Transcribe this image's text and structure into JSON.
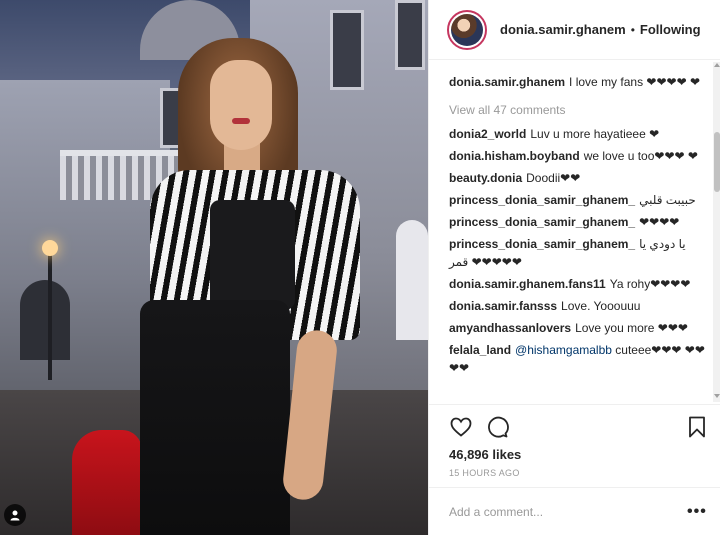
{
  "header": {
    "username": "donia.samir.ghanem",
    "separator": "•",
    "follow_status": "Following"
  },
  "caption": {
    "username": "donia.samir.ghanem",
    "text": "I love my fans ❤❤❤❤ ❤"
  },
  "view_all_comments": "View all 47 comments",
  "comments": [
    {
      "user": "donia2_world",
      "text": "Luv u more hayatieee ❤"
    },
    {
      "user": "donia.hisham.boyband",
      "text": "we love u too❤❤❤ ❤"
    },
    {
      "user": "beauty.donia",
      "text": "Doodii❤❤"
    },
    {
      "user": "princess_donia_samir_ghanem_",
      "text": "حبيبت قلبي"
    },
    {
      "user": "princess_donia_samir_ghanem_",
      "text": "❤❤❤❤"
    },
    {
      "user": "princess_donia_samir_ghanem_",
      "text": "يا دودي يا قمر ❤❤❤❤❤"
    },
    {
      "user": "donia.samir.ghanem.fans11",
      "text": "Ya rohy❤❤❤❤"
    },
    {
      "user": "donia.samir.fansss",
      "text": "Love. Yooouuu"
    },
    {
      "user": "amyandhassanlovers",
      "text": "Love you more ❤❤❤"
    },
    {
      "user": "felala_land",
      "mention": "@hishamgamalbb",
      "text": "cuteee❤❤❤ ❤❤❤❤"
    }
  ],
  "likes": "46,896 likes",
  "timestamp": "15 HOURS AGO",
  "add_comment_placeholder": "Add a comment...",
  "more_options": "•••",
  "icons": {
    "like": "heart-icon",
    "comment": "comment-bubble-icon",
    "save": "bookmark-icon",
    "tagged_user": "user-tag-icon"
  }
}
